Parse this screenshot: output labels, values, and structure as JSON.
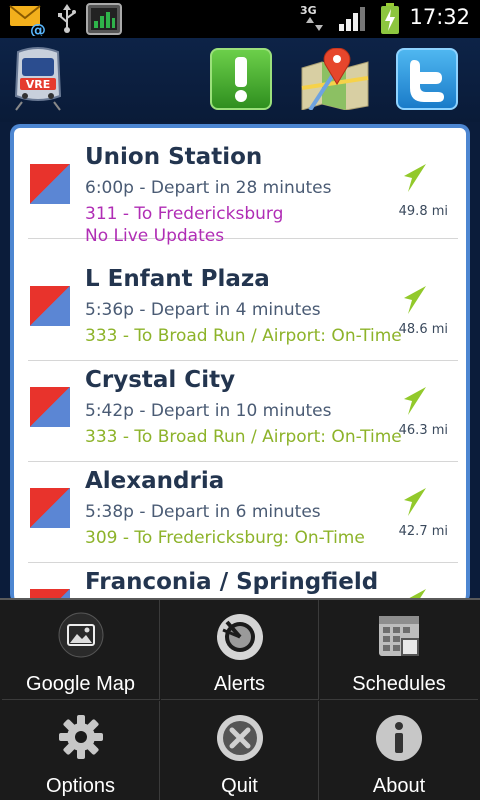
{
  "status_bar": {
    "time": "17:32",
    "network": "3G",
    "icons": [
      "email-notification-icon",
      "usb-icon",
      "stock-chart-icon",
      "signal-icon",
      "battery-charging-icon"
    ]
  },
  "app": {
    "logo_text": "VRE",
    "header_buttons": [
      "alert-icon",
      "map-pin-icon",
      "twitter-icon"
    ]
  },
  "departures": [
    {
      "station": "Union Station",
      "time": "6:00p -  Depart in 28 minutes",
      "train": "311 - To Fredericksburg",
      "status": "No Live Updates",
      "distance": "49.8 mi",
      "train_color": "#b02db5"
    },
    {
      "station": "L Enfant Plaza",
      "time": "5:36p -  Depart in 4 minutes",
      "train": "333 - To Broad Run / Airport: On-Time",
      "distance": "48.6 mi",
      "train_color": "#8db32a"
    },
    {
      "station": "Crystal City",
      "time": "5:42p -  Depart in 10 minutes",
      "train": "333 - To Broad Run / Airport: On-Time",
      "distance": "46.3 mi",
      "train_color": "#8db32a"
    },
    {
      "station": "Alexandria",
      "time": "5:38p -  Depart in 6 minutes",
      "train": "309 - To Fredericksburg: On-Time",
      "distance": "42.7 mi",
      "train_color": "#8db32a"
    },
    {
      "station": "Franconia / Springfield"
    }
  ],
  "menu": {
    "items": [
      {
        "label": "Google Map",
        "icon": "map-icon"
      },
      {
        "label": "Alerts",
        "icon": "alerts-icon"
      },
      {
        "label": "Schedules",
        "icon": "calendar-icon"
      },
      {
        "label": "Options",
        "icon": "gear-icon"
      },
      {
        "label": "Quit",
        "icon": "close-icon"
      },
      {
        "label": "About",
        "icon": "info-icon"
      }
    ]
  },
  "colors": {
    "flag_red": "#e8332c",
    "flag_blue": "#5b86d4",
    "station_text": "#23354f",
    "on_time_green": "#8db32a",
    "no_live_purple": "#b02db5",
    "panel_border": "#4d86d1",
    "menu_bg": "#1b1b1b"
  }
}
